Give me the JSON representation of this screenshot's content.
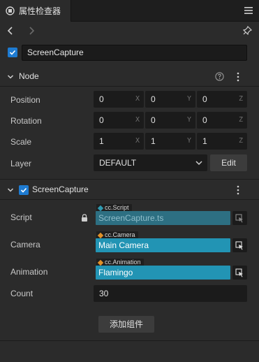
{
  "panel": {
    "tab_title": "属性检查器",
    "tab_icon": "inspector-icon",
    "menu_icon": "hamburger-menu-icon"
  },
  "nav": {
    "back_icon": "chevron-left-icon",
    "forward_icon": "chevron-right-icon",
    "pin_icon": "pin-icon"
  },
  "node_name": {
    "enabled": true,
    "value": "ScreenCapture"
  },
  "node_section": {
    "title": "Node",
    "expanded": true,
    "position": {
      "label": "Position",
      "x": "0",
      "y": "0",
      "z": "0"
    },
    "rotation": {
      "label": "Rotation",
      "x": "0",
      "y": "0",
      "z": "0"
    },
    "scale": {
      "label": "Scale",
      "x": "1",
      "y": "1",
      "z": "1"
    },
    "layer": {
      "label": "Layer",
      "value": "DEFAULT",
      "edit_label": "Edit"
    },
    "axis": {
      "x": "X",
      "y": "Y",
      "z": "Z"
    }
  },
  "component": {
    "title": "ScreenCapture",
    "enabled": true,
    "expanded": true,
    "script": {
      "label": "Script",
      "type": "cc.Script",
      "value": "ScreenCapture.ts",
      "type_color": "#2f9ab0",
      "field_color": "#2d6f82"
    },
    "camera": {
      "label": "Camera",
      "type": "cc.Camera",
      "value": "Main Camera",
      "type_color": "#e0902a",
      "field_color": "#2294b4"
    },
    "animation": {
      "label": "Animation",
      "type": "cc.Animation",
      "value": "Flamingo",
      "type_color": "#e0902a",
      "field_color": "#2294b4"
    },
    "count": {
      "label": "Count",
      "value": "30"
    }
  },
  "add_component_label": "添加组件",
  "colors": {
    "accent": "#1e7bd1",
    "background": "#2b2b2b",
    "field": "#1b1b1b"
  }
}
